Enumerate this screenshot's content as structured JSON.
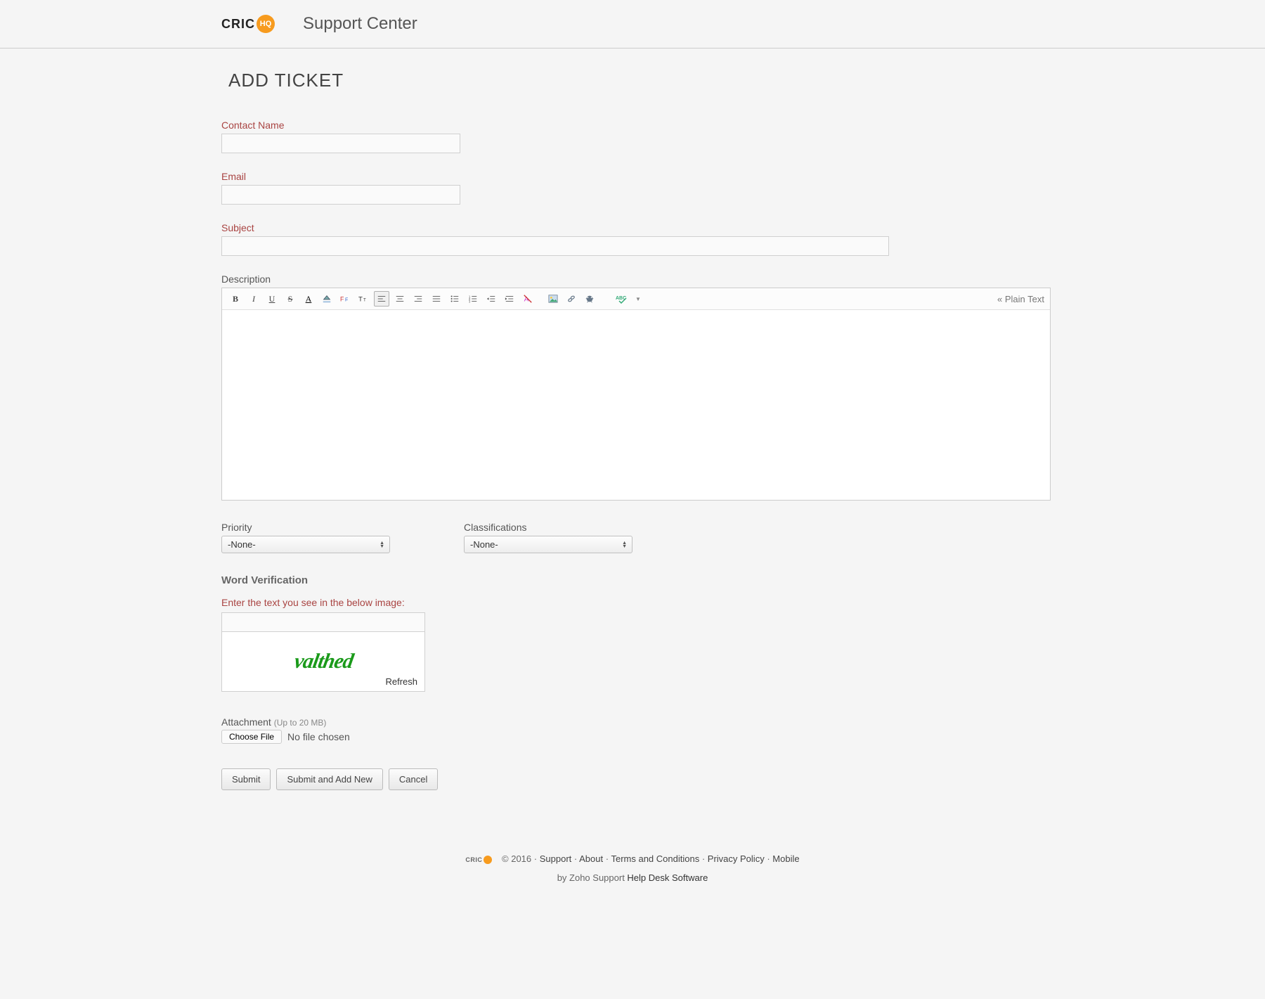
{
  "header": {
    "brand_left": "CRIC",
    "brand_circle": "HQ",
    "title": "Support Center"
  },
  "page": {
    "title": "ADD TICKET"
  },
  "form": {
    "contact_name_label": "Contact Name",
    "contact_name_value": "",
    "email_label": "Email",
    "email_value": "",
    "subject_label": "Subject",
    "subject_value": "",
    "description_label": "Description",
    "plain_text_toggle": "« Plain Text",
    "priority_label": "Priority",
    "priority_value": "-None-",
    "classifications_label": "Classifications",
    "classifications_value": "-None-"
  },
  "toolbar": {
    "bold": "B",
    "italic": "I",
    "underline": "U",
    "strike": "S",
    "font_color": "A",
    "bg_color": "◆",
    "font_family": "F",
    "font_size": "T",
    "align_left": "≡",
    "align_center": "≡",
    "align_right": "≡",
    "align_justify": "≡",
    "ul": "•≡",
    "ol": "1≡",
    "outdent": "⇤",
    "indent": "⇥",
    "clear_format": "A",
    "image": "🖼",
    "link": "🔗",
    "html": "⚙",
    "spell": "abc",
    "dropdown": "▼"
  },
  "verification": {
    "heading": "Word Verification",
    "instruction": "Enter the text you see in the below image:",
    "input_value": "",
    "captcha_text": "valthed",
    "refresh": "Refresh"
  },
  "attachment": {
    "label": "Attachment",
    "hint": "(Up to 20 MB)",
    "choose": "Choose File",
    "status": "No file chosen"
  },
  "buttons": {
    "submit": "Submit",
    "submit_add": "Submit and Add New",
    "cancel": "Cancel"
  },
  "footer": {
    "copyright": "© 2016",
    "links": [
      "Support",
      "About",
      "Terms and Conditions",
      "Privacy Policy",
      "Mobile"
    ],
    "separator": " · ",
    "byline_prefix": "by Zoho Support ",
    "byline_link": "Help Desk Software"
  }
}
